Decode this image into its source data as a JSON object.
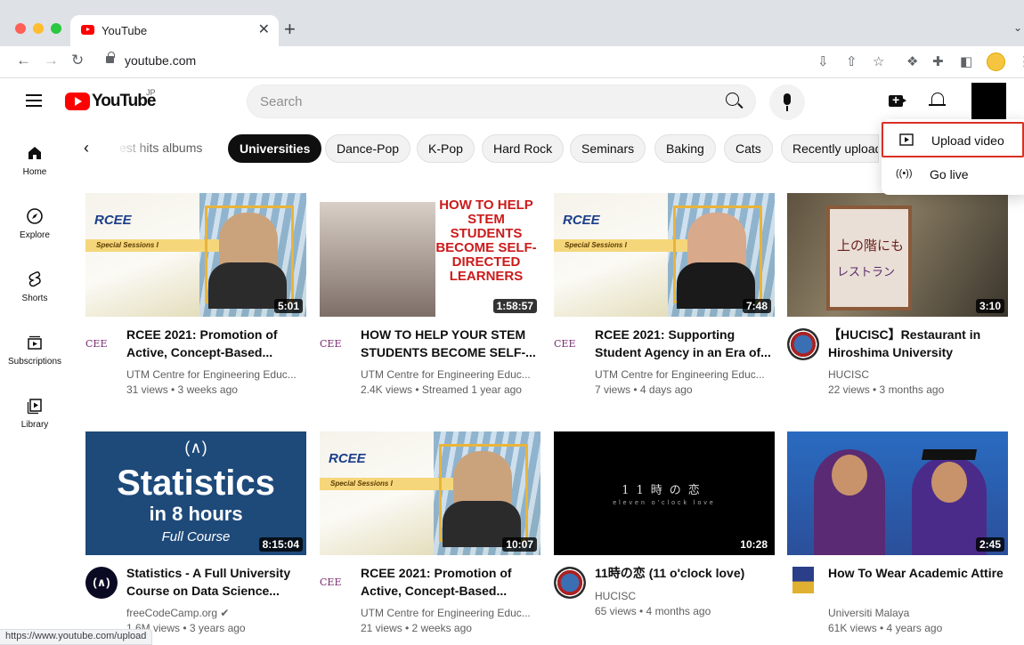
{
  "browser": {
    "tab_title": "YouTube",
    "tab_close": "✕",
    "new_tab": "+",
    "url": "youtube.com",
    "status_url": "https://www.youtube.com/upload"
  },
  "header": {
    "logo_text": "YouTube",
    "country_code": "JP",
    "search_placeholder": "Search"
  },
  "rail": [
    {
      "label": "Home",
      "icon": "home-icon"
    },
    {
      "label": "Explore",
      "icon": "compass-icon"
    },
    {
      "label": "Shorts",
      "icon": "shorts-icon"
    },
    {
      "label": "Subscriptions",
      "icon": "subscriptions-icon"
    },
    {
      "label": "Library",
      "icon": "library-icon"
    }
  ],
  "chips": [
    "est hits albums",
    "Universities",
    "Dance-Pop",
    "K-Pop",
    "Hard Rock",
    "Seminars",
    "Baking",
    "Cats",
    "Recently uploaded"
  ],
  "active_chip": "Universities",
  "menu": {
    "upload": "Upload video",
    "live": "Go live"
  },
  "videos": [
    {
      "title": "RCEE 2021: Promotion of Active, Concept-Based...",
      "channel": "UTM Centre for Engineering Educ...",
      "meta": "31 views • 3 weeks ago",
      "duration": "5:01"
    },
    {
      "title": "HOW TO HELP YOUR STEM STUDENTS BECOME SELF-...",
      "channel": "UTM Centre for Engineering Educ...",
      "meta": "2.4K views • Streamed 1 year ago",
      "duration": "1:58:57"
    },
    {
      "title": "RCEE 2021: Supporting Student Agency in an Era of...",
      "channel": "UTM Centre for Engineering Educ...",
      "meta": "7 views • 4 days ago",
      "duration": "7:48"
    },
    {
      "title": "【HUCISC】Restaurant in Hiroshima University",
      "channel": "HUCISC",
      "meta": "22 views • 3 months ago",
      "duration": "3:10"
    },
    {
      "title": "Statistics - A Full University Course on Data Science...",
      "channel": "freeCodeCamp.org ✔",
      "meta": "1.6M views • 3 years ago",
      "duration": "8:15:04"
    },
    {
      "title": "RCEE 2021: Promotion of Active, Concept-Based...",
      "channel": "UTM Centre for Engineering Educ...",
      "meta": "21 views • 2 weeks ago",
      "duration": "10:07"
    },
    {
      "title": "11時の恋 (11 o'clock love)",
      "channel": "HUCISC",
      "meta": "65 views • 4 months ago",
      "duration": "10:28"
    },
    {
      "title": "How To Wear Academic Attire",
      "channel": "Universiti Malaya",
      "meta": "61K views • 4 years ago",
      "duration": "2:45"
    }
  ],
  "thumbs": {
    "rcee_logo": "RCEE",
    "rcee_sub": "Special Sessions I",
    "stem_text": "HOW TO HELP STEM STUDENTS BECOME SELF-DIRECTED LEARNERS",
    "stat_top": "(∧)",
    "stat_big": "Statistics",
    "stat_mid": "in 8 hours",
    "stat_small": "Full Course",
    "dark_jp": "11時の恋",
    "dark_en": "eleven o'clock love",
    "sign_l1": "上の階にも",
    "sign_l2": "レストラン"
  },
  "channel_avatar_text": {
    "cee": "CEE"
  }
}
